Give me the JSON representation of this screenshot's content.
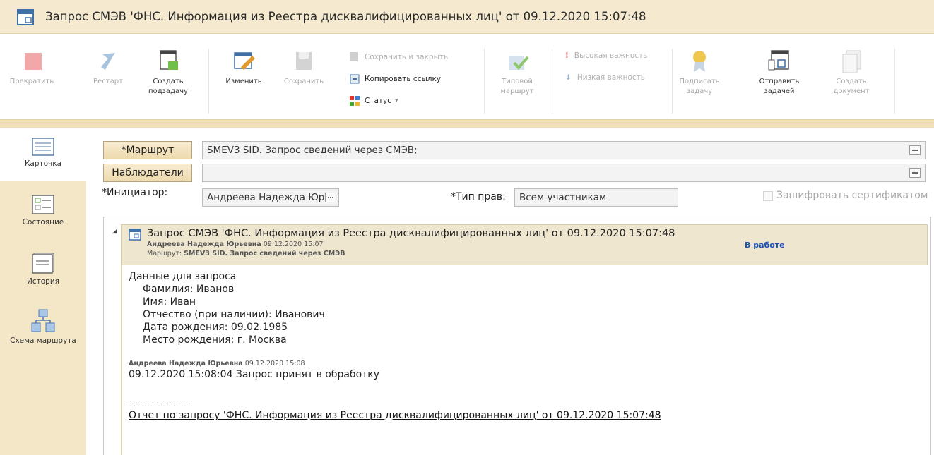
{
  "window": {
    "title": "Запрос СМЭВ 'ФНС. Информация из Реестра дисквалифицированных лиц' от 09.12.2020 15:07:48"
  },
  "toolbar": {
    "stop": "Прекратить",
    "restart": "Рестарт",
    "create_subtask_1": "Создать",
    "create_subtask_2": "подзадачу",
    "edit": "Изменить",
    "save": "Сохранить",
    "save_close": "Сохранить и закрыть",
    "copy_link": "Копировать ссылку",
    "status": "Статус",
    "typical_route_1": "Типовой",
    "typical_route_2": "маршрут",
    "high_importance": "Высокая важность",
    "low_importance": "Низкая важность",
    "sign_task_1": "Подписать",
    "sign_task_2": "задачу",
    "send_as_task_1": "Отправить",
    "send_as_task_2": "задачей",
    "create_document_1": "Создать",
    "create_document_2": "документ"
  },
  "sidebar": {
    "items": [
      {
        "label": "Карточка",
        "icon": "card-icon"
      },
      {
        "label": "Состояние",
        "icon": "state-icon"
      },
      {
        "label": "История",
        "icon": "history-icon"
      },
      {
        "label": "Схема маршрута",
        "icon": "route-scheme-icon"
      }
    ]
  },
  "form": {
    "route_button": "*Маршрут",
    "route_value": "SMEV3 SID. Запрос сведений через СМЭВ;",
    "watchers_button": "Наблюдатели",
    "watchers_value": "",
    "initiator_label": "*Инициатор:",
    "initiator_value": "Андреева Надежда Юр",
    "rights_label": "*Тип прав:",
    "rights_value": "Всем участникам",
    "encrypt_label": "Зашифровать сертификатом"
  },
  "task": {
    "title": "Запрос СМЭВ 'ФНС. Информация из Реестра дисквалифицированных лиц' от 09.12.2020 15:07:48",
    "author": "Андреева Надежда Юрьевна",
    "date": "09.12.2020 15:07",
    "route_label": "Маршрут:",
    "route_value": "SMEV3 SID. Запрос сведений через СМЭВ",
    "status": "В работе",
    "body_lines": [
      "Данные для запроса",
      "Фамилия: Иванов",
      "Имя: Иван",
      "Отчество (при наличии): Иванович",
      "Дата рождения: 09.02.1985",
      "Место рождения: г. Москва"
    ],
    "comment_author": "Андреева Надежда Юрьевна",
    "comment_date": "09.12.2020 15:08",
    "comment_text": "09.12.2020 15:08:04 Запрос принят в обработку",
    "separator": "--------------------",
    "report_link": "Отчет по запросу 'ФНС. Информация из Реестра дисквалифицированных лиц' от 09.12.2020 15:07:48"
  }
}
